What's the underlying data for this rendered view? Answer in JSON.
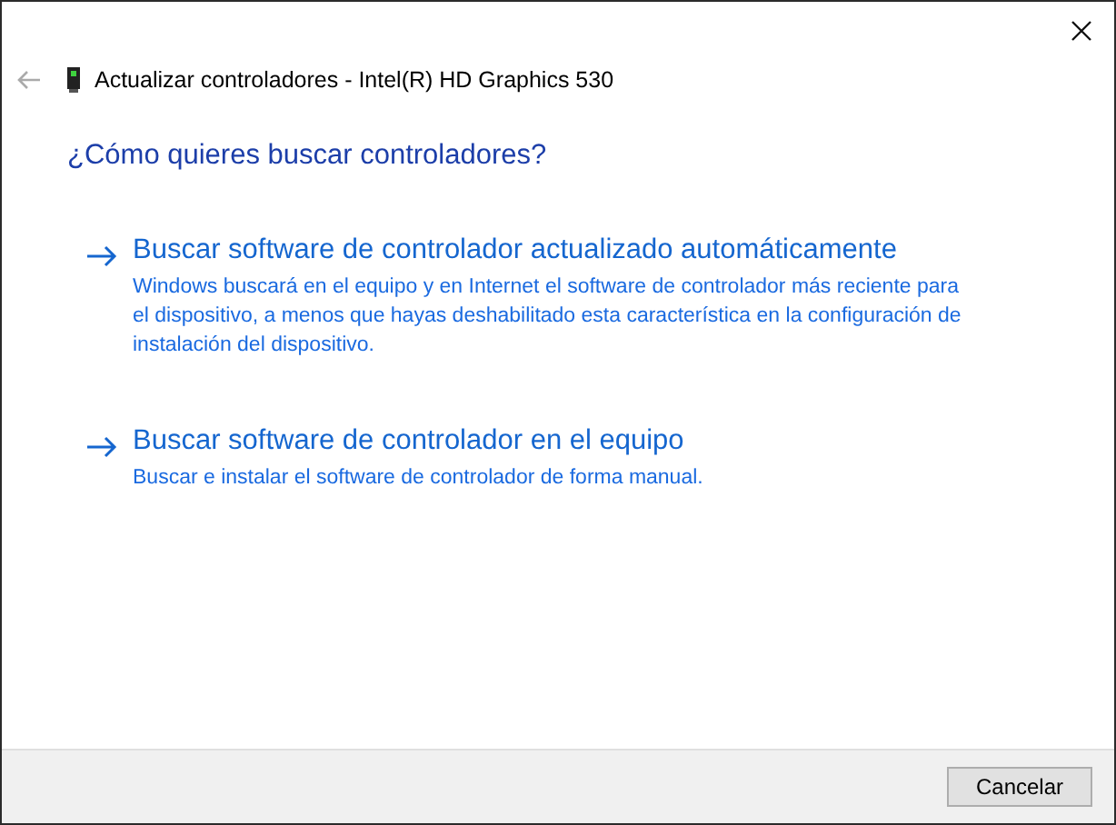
{
  "window": {
    "title": "Actualizar controladores - Intel(R) HD Graphics 530"
  },
  "question": "¿Cómo quieres buscar controladores?",
  "options": [
    {
      "title": "Buscar software de controlador actualizado automáticamente",
      "description": "Windows buscará en el equipo y en Internet el software de controlador más reciente para el dispositivo, a menos que hayas deshabilitado esta característica en la configuración de instalación del dispositivo."
    },
    {
      "title": "Buscar software de controlador en el equipo",
      "description": "Buscar e instalar el software de controlador de forma manual."
    }
  ],
  "buttons": [
    "Cancelar"
  ]
}
